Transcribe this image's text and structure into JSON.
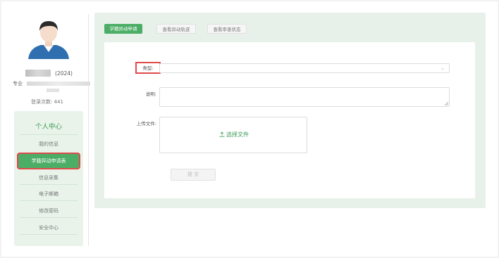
{
  "profile": {
    "year": "(2024)",
    "major_label": "专业",
    "login_label": "登录次数:",
    "login_count": "441"
  },
  "menu": {
    "title": "个人中心",
    "items": [
      {
        "label": "我的信息",
        "active": false
      },
      {
        "label": "学籍异动申请表",
        "active": true
      },
      {
        "label": "信息采集",
        "active": false
      },
      {
        "label": "电子邮箱",
        "active": false
      },
      {
        "label": "修改密码",
        "active": false
      },
      {
        "label": "安全中心",
        "active": false
      }
    ]
  },
  "tabs": [
    {
      "label": "学籍异动申请",
      "active": true
    },
    {
      "label": "查看异动轨迹",
      "active": false
    },
    {
      "label": "查看审查状态",
      "active": false
    }
  ],
  "form": {
    "type_label": "类型:",
    "type_value": "",
    "desc_label": "说明:",
    "desc_value": "",
    "upload_label": "上传文件:",
    "upload_button": "选择文件",
    "submit_label": "提 交"
  },
  "colors": {
    "accent": "#4cae66",
    "highlight": "#e04a4a",
    "panel_bg": "#e8f1e9"
  },
  "icons": [
    "avatar-image",
    "chevron-down-icon",
    "upload-icon",
    "resize-handle-icon"
  ]
}
